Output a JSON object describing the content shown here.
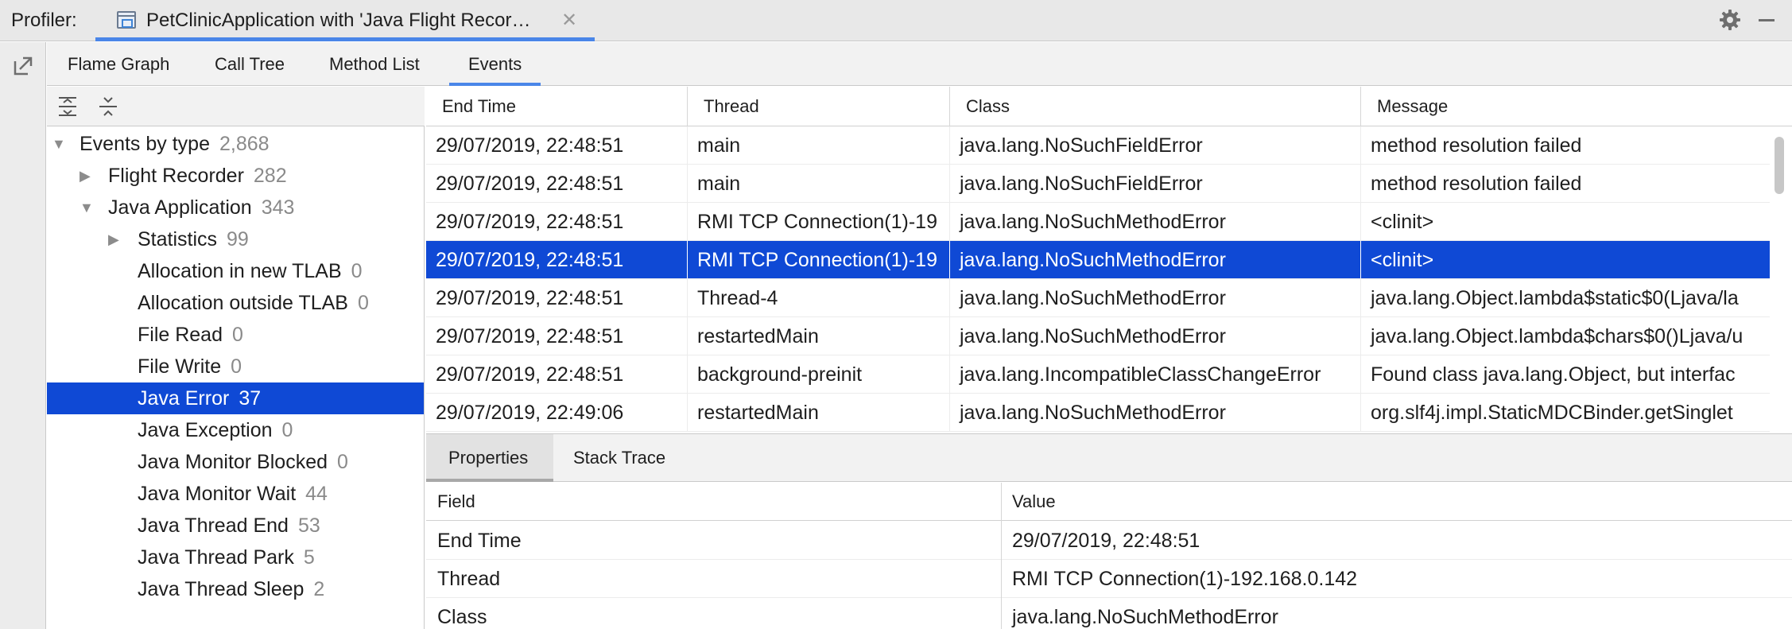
{
  "titlebar": {
    "label": "Profiler:",
    "tab_title": "PetClinicApplication with 'Java Flight Recor…",
    "close_glyph": "✕",
    "settings_icon": "gear-icon",
    "minimize_icon": "minimize-icon"
  },
  "sidebar": {
    "export_icon": "export-arrow-icon"
  },
  "views": {
    "tabs": [
      "Flame Graph",
      "Call Tree",
      "Method List",
      "Events"
    ],
    "active": "Events"
  },
  "tree": {
    "toolbar": {
      "expand_all_icon": "expand-all-icon",
      "collapse_all_icon": "collapse-all-icon"
    },
    "nodes": [
      {
        "label": "Events by type",
        "count": "2,868",
        "expanded": true
      },
      {
        "label": "Flight Recorder",
        "count": "282",
        "expanded": false
      },
      {
        "label": "Java Application",
        "count": "343",
        "expanded": true
      },
      {
        "label": "Statistics",
        "count": "99",
        "expanded": false
      },
      {
        "label": "Allocation in new TLAB",
        "count": "0"
      },
      {
        "label": "Allocation outside TLAB",
        "count": "0"
      },
      {
        "label": "File Read",
        "count": "0"
      },
      {
        "label": "File Write",
        "count": "0"
      },
      {
        "label": "Java Error",
        "count": "37",
        "selected": true
      },
      {
        "label": "Java Exception",
        "count": "0"
      },
      {
        "label": "Java Monitor Blocked",
        "count": "0"
      },
      {
        "label": "Java Monitor Wait",
        "count": "44"
      },
      {
        "label": "Java Thread End",
        "count": "53"
      },
      {
        "label": "Java Thread Park",
        "count": "5"
      },
      {
        "label": "Java Thread Sleep",
        "count": "2"
      }
    ]
  },
  "events": {
    "columns": [
      "End Time",
      "Thread",
      "Class",
      "Message"
    ],
    "rows": [
      {
        "end_time": "29/07/2019, 22:48:51",
        "thread": "main",
        "class": "java.lang.NoSuchFieldError",
        "message": "method resolution failed"
      },
      {
        "end_time": "29/07/2019, 22:48:51",
        "thread": "main",
        "class": "java.lang.NoSuchFieldError",
        "message": "method resolution failed"
      },
      {
        "end_time": "29/07/2019, 22:48:51",
        "thread": "RMI TCP Connection(1)-19",
        "class": "java.lang.NoSuchMethodError",
        "message": "<clinit>"
      },
      {
        "end_time": "29/07/2019, 22:48:51",
        "thread": "RMI TCP Connection(1)-19",
        "class": "java.lang.NoSuchMethodError",
        "message": "<clinit>",
        "selected": true
      },
      {
        "end_time": "29/07/2019, 22:48:51",
        "thread": "Thread-4",
        "class": "java.lang.NoSuchMethodError",
        "message": "java.lang.Object.lambda$static$0(Ljava/la"
      },
      {
        "end_time": "29/07/2019, 22:48:51",
        "thread": "restartedMain",
        "class": "java.lang.NoSuchMethodError",
        "message": "java.lang.Object.lambda$chars$0()Ljava/u"
      },
      {
        "end_time": "29/07/2019, 22:48:51",
        "thread": "background-preinit",
        "class": "java.lang.IncompatibleClassChangeError",
        "message": "Found class java.lang.Object, but interfac"
      },
      {
        "end_time": "29/07/2019, 22:49:06",
        "thread": "restartedMain",
        "class": "java.lang.NoSuchMethodError",
        "message": "org.slf4j.impl.StaticMDCBinder.getSinglet"
      }
    ]
  },
  "details": {
    "tabs": [
      "Properties",
      "Stack Trace"
    ],
    "active": "Properties",
    "columns": [
      "Field",
      "Value"
    ],
    "rows": [
      {
        "field": "End Time",
        "value": "29/07/2019, 22:48:51"
      },
      {
        "field": "Thread",
        "value": "RMI TCP Connection(1)-192.168.0.142"
      },
      {
        "field": "Class",
        "value": "java.lang.NoSuchMethodError"
      }
    ]
  },
  "colors": {
    "selection": "#0f49d5",
    "tab_underline": "#4a86e8",
    "count_gray": "#8a8a8a"
  }
}
